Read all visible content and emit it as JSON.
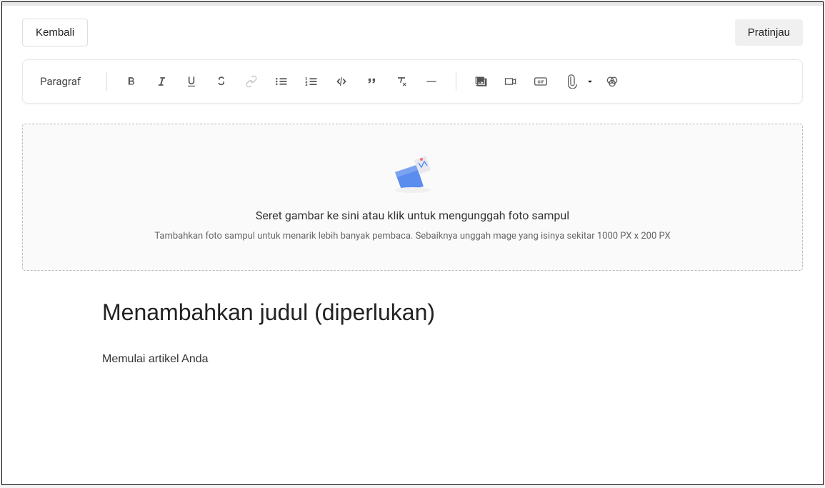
{
  "header": {
    "back_label": "Kembali",
    "preview_label": "Pratinjau"
  },
  "toolbar": {
    "format_label": "Paragraf"
  },
  "upload": {
    "title": "Seret gambar ke sini atau klik untuk mengunggah foto sampul",
    "subtitle": "Tambahkan foto sampul untuk menarik lebih banyak pembaca. Sebaiknya unggah mage yang isinya sekitar 1000 PX x 200 PX"
  },
  "editor": {
    "title_placeholder": "Menambahkan judul (diperlukan)",
    "body_placeholder": "Memulai artikel Anda"
  }
}
